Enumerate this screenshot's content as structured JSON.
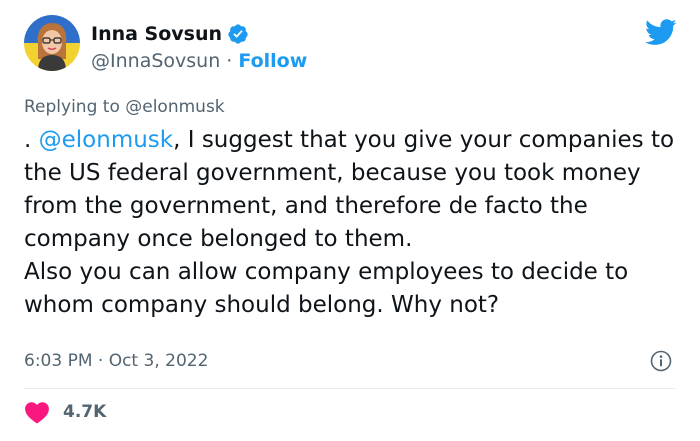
{
  "author": {
    "display_name": "Inna Sovsun",
    "handle": "@InnaSovsun",
    "separator": " · ",
    "follow_label": "Follow"
  },
  "reply": {
    "prefix": "Replying to ",
    "target": "@elonmusk"
  },
  "tweet": {
    "lead": ". ",
    "mention": "@elonmusk",
    "body_1": ", I suggest that you give your companies to the US federal government, because you took money from the government, and therefore de facto the company once belonged to them.",
    "body_2": "Also you can allow company employees to decide to whom company should belong. Why not?"
  },
  "meta": {
    "timestamp": "6:03 PM · Oct 3, 2022"
  },
  "engagement": {
    "likes": "4.7K"
  },
  "colors": {
    "accent": "#1d9bf0",
    "heart": "#f91880",
    "muted": "#536471",
    "text": "#0f1419"
  },
  "icons": {
    "verified": "verified-badge-icon",
    "platform": "twitter-bird-icon",
    "info": "info-icon",
    "like": "heart-icon"
  }
}
